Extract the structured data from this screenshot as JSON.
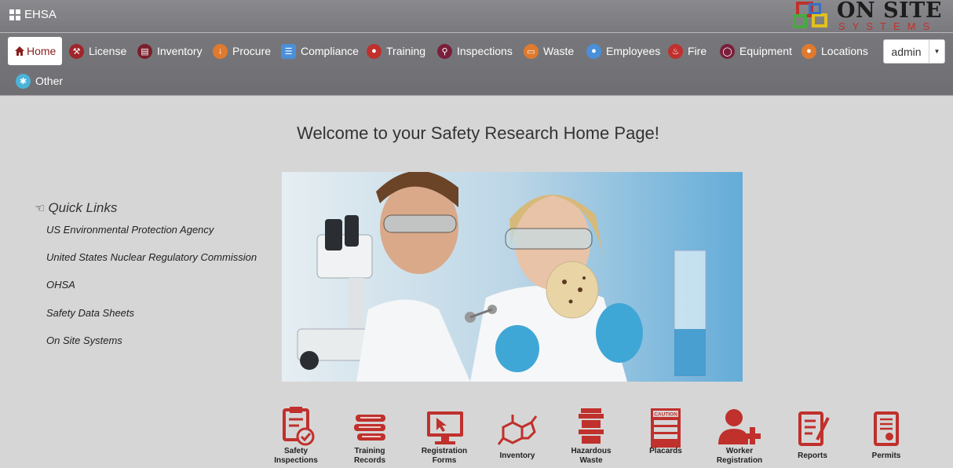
{
  "app": {
    "title": "EHSA"
  },
  "logo": {
    "big": "ON SITE",
    "small": "SYSTEMS"
  },
  "nav": {
    "items": [
      {
        "label": "Home",
        "icon": "home-icon",
        "color": "#8b1f1d"
      },
      {
        "label": "License",
        "icon": "wrench-icon",
        "color": "#a0252b"
      },
      {
        "label": "Inventory",
        "icon": "truck-icon",
        "color": "#7a1f2b"
      },
      {
        "label": "Procure",
        "icon": "download-arrow-icon",
        "color": "#e07a2e"
      },
      {
        "label": "Compliance",
        "icon": "clipboard-icon",
        "color": "#4a8fd9"
      },
      {
        "label": "Training",
        "icon": "person-icon",
        "color": "#c0302c"
      },
      {
        "label": "Inspections",
        "icon": "magnifier-icon",
        "color": "#7a1f3b"
      },
      {
        "label": "Waste",
        "icon": "bin-icon",
        "color": "#e07a2e"
      },
      {
        "label": "Employees",
        "icon": "people-icon",
        "color": "#4a8fd9"
      },
      {
        "label": "Fire",
        "icon": "flame-icon",
        "color": "#c0302c"
      },
      {
        "label": "Equipment",
        "icon": "gauge-icon",
        "color": "#7a1f3b"
      },
      {
        "label": "Locations",
        "icon": "map-pin-icon",
        "color": "#e07a2e"
      },
      {
        "label": "Other",
        "icon": "gear-icon",
        "color": "#4ab4d9"
      }
    ]
  },
  "user": {
    "label": "admin"
  },
  "welcome": "Welcome to your Safety Research Home Page!",
  "quick_links": {
    "title": "Quick Links",
    "links": [
      "US Environmental Protection Agency",
      "United States Nuclear Regulatory Commission",
      "OHSA",
      "Safety Data Sheets",
      "On Site Systems"
    ]
  },
  "tiles": [
    {
      "line1": "Safety",
      "line2": "Inspections",
      "icon": "clipboard-check-icon"
    },
    {
      "line1": "Training",
      "line2": "Records",
      "icon": "books-icon"
    },
    {
      "line1": "Registration",
      "line2": "Forms",
      "icon": "monitor-cursor-icon"
    },
    {
      "line1": "Inventory",
      "line2": "",
      "icon": "molecule-icon"
    },
    {
      "line1": "Hazardous",
      "line2": "Waste",
      "icon": "barrel-icon"
    },
    {
      "line1": "Placards",
      "line2": "",
      "icon": "caution-placard-icon"
    },
    {
      "line1": "Worker",
      "line2": "Registration",
      "icon": "add-person-icon"
    },
    {
      "line1": "Reports",
      "line2": "",
      "icon": "report-pen-icon"
    },
    {
      "line1": "Permits",
      "line2": "",
      "icon": "permit-doc-icon"
    }
  ],
  "placard_text": "CAUTION",
  "accent": "#c0302c"
}
